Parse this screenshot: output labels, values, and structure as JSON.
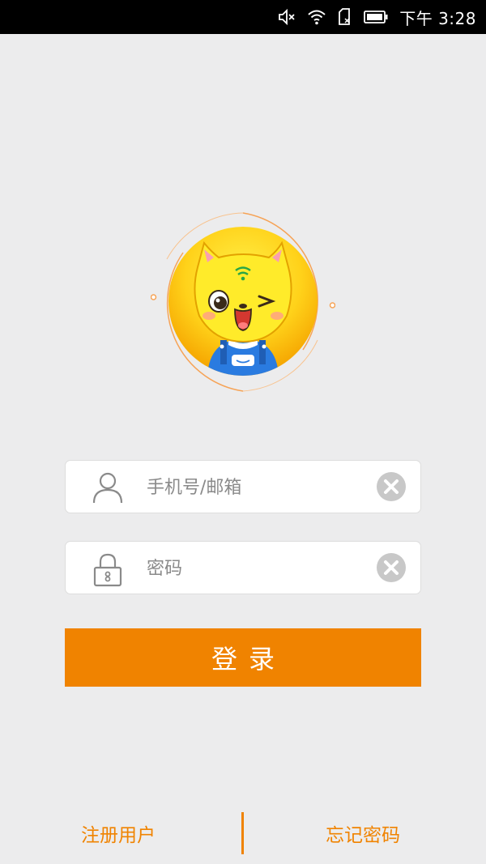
{
  "status_bar": {
    "time": "下午 3:28",
    "icons": [
      "mute-icon",
      "wifi-icon",
      "no-sim-icon",
      "battery-icon"
    ]
  },
  "colors": {
    "accent": "#f08300",
    "background": "#ececed",
    "avatar_ring": "#f6a356",
    "avatar_face": "#ffe21e"
  },
  "login_form": {
    "phone_placeholder": "手机号/邮箱",
    "password_placeholder": "密码",
    "phone_value": "",
    "password_value": "",
    "login_label": "登录"
  },
  "footer": {
    "register_label": "注册用户",
    "forgot_label": "忘记密码"
  }
}
